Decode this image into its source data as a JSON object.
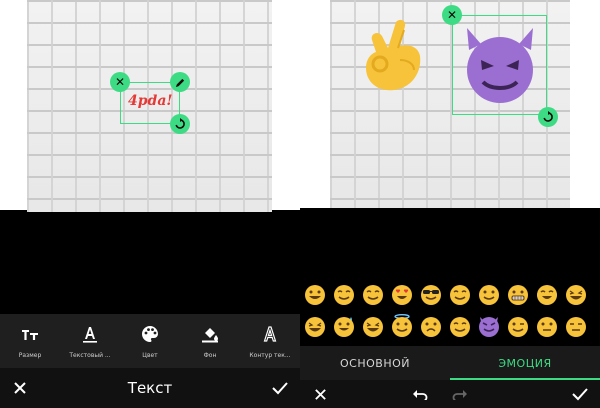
{
  "left": {
    "sticker_text": "4pda!",
    "toolbar": {
      "size_label": "Размер",
      "font_label": "Текстовый ...",
      "color_label": "Цвет",
      "background_label": "Фон",
      "outline_label": "Контур тек..."
    },
    "title": "Текст"
  },
  "right": {
    "tabs": {
      "basic": "ОСНОВНОЙ",
      "emotion": "ЭМОЦИЯ"
    },
    "emoji_rows": [
      [
        "grinning",
        "yum",
        "relieved",
        "heart-eyes",
        "sunglasses",
        "smirk",
        "smile",
        "grimacing",
        "joy",
        "laughing"
      ],
      [
        "grin",
        "sweat-smile",
        "laughing-closed",
        "innocent",
        "worried",
        "blush",
        "smiling-imp",
        "wink",
        "neutral",
        "expressionless"
      ]
    ]
  },
  "colors": {
    "accent": "#3ddc84",
    "sticker_text": "#e53935",
    "emoji_yellow": "#f7c33b",
    "devil_purple": "#9b6fd1"
  }
}
